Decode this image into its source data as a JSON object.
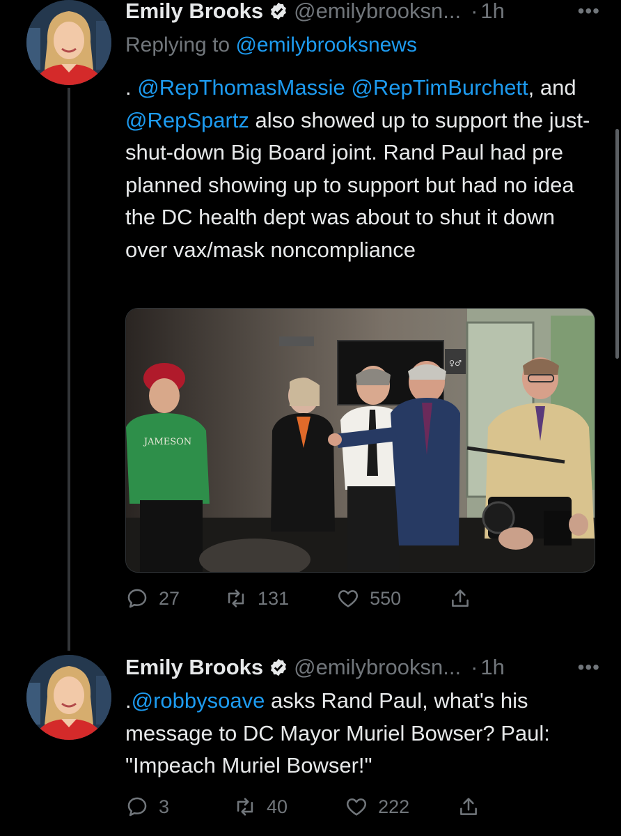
{
  "scrollbar": true,
  "tweets": [
    {
      "author_name": "Emily Brooks",
      "handle": "@emilybrooksn...",
      "separator": "·",
      "time": "1h",
      "more": "•••",
      "replying_prefix": "Replying to ",
      "replying_to": "@emilybrooksnews",
      "text": {
        "lead": ". ",
        "m1": "@RepThomasMassie",
        "s1": " ",
        "m2": "@RepTimBurchett",
        "s2": ", and ",
        "m3": "@RepSpartz",
        "rest": " also showed up to support the just-shut-down Big Board joint. Rand Paul had pre planned showing up to support but had no idea the DC health dept was about to shut it down over vax/mask noncompliance"
      },
      "photo": {
        "shirt_text": "JAMESON",
        "door_sign": "♀♂"
      },
      "actions": {
        "replies": "27",
        "retweets": "131",
        "likes": "550"
      }
    },
    {
      "author_name": "Emily Brooks",
      "handle": "@emilybrooksn...",
      "separator": "·",
      "time": "1h",
      "more": "•••",
      "text": {
        "lead": ".",
        "m1": "@robbysoave",
        "rest": " asks Rand Paul, what's his message to DC Mayor Muriel Bowser? Paul: \"Impeach Muriel Bowser!\""
      },
      "actions": {
        "replies": "3",
        "retweets": "40",
        "likes": "222"
      }
    }
  ],
  "colors": {
    "background": "#000000",
    "link": "#1d9bf0",
    "muted": "#71767b",
    "verified": "#e7e9ea"
  }
}
